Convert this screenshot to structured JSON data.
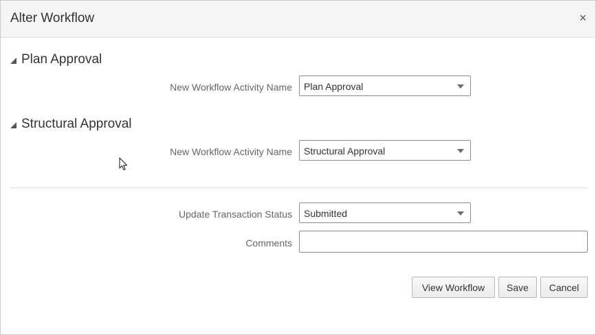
{
  "dialog": {
    "title": "Alter Workflow",
    "close_glyph": "×"
  },
  "sections": [
    {
      "title": "Plan Approval",
      "field_label": "New Workflow Activity Name",
      "selected_value": "Plan Approval"
    },
    {
      "title": "Structural Approval",
      "field_label": "New Workflow Activity Name",
      "selected_value": "Structural Approval"
    }
  ],
  "status": {
    "label": "Update Transaction Status",
    "selected_value": "Submitted"
  },
  "comments": {
    "label": "Comments",
    "value": ""
  },
  "buttons": {
    "view_workflow": "View Workflow",
    "save": "Save",
    "cancel": "Cancel"
  },
  "icons": {
    "close": "close-icon",
    "disclosure": "triangle-expanded-icon",
    "caret": "chevron-down-icon",
    "cursor": "mouse-pointer-icon"
  }
}
